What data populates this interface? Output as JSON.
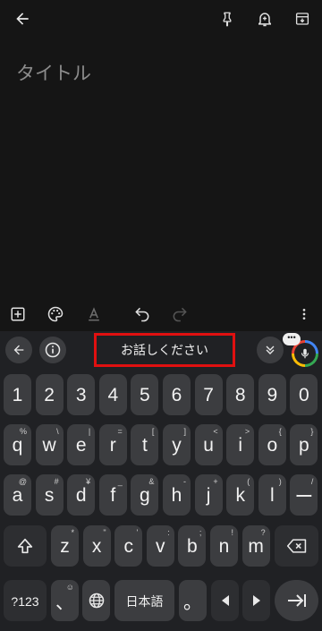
{
  "note": {
    "title_placeholder": "タイトル"
  },
  "keyboard": {
    "suggestion": "お話しください",
    "number_row": [
      "1",
      "2",
      "3",
      "4",
      "5",
      "6",
      "7",
      "8",
      "9",
      "0"
    ],
    "row1": [
      {
        "k": "q",
        "a": "%"
      },
      {
        "k": "w",
        "a": "\\"
      },
      {
        "k": "e",
        "a": "|"
      },
      {
        "k": "r",
        "a": "="
      },
      {
        "k": "t",
        "a": "["
      },
      {
        "k": "y",
        "a": "]"
      },
      {
        "k": "u",
        "a": "<"
      },
      {
        "k": "i",
        "a": ">"
      },
      {
        "k": "o",
        "a": "{"
      },
      {
        "k": "p",
        "a": "}"
      }
    ],
    "row2": [
      {
        "k": "a",
        "a": "@"
      },
      {
        "k": "s",
        "a": "#"
      },
      {
        "k": "d",
        "a": "¥"
      },
      {
        "k": "f",
        "a": "_"
      },
      {
        "k": "g",
        "a": "&"
      },
      {
        "k": "h",
        "a": "-"
      },
      {
        "k": "j",
        "a": "+"
      },
      {
        "k": "k",
        "a": "("
      },
      {
        "k": "l",
        "a": ")"
      },
      {
        "k": "ー",
        "a": "/"
      }
    ],
    "row3": [
      {
        "k": "z",
        "a": "*"
      },
      {
        "k": "x",
        "a": "\""
      },
      {
        "k": "c",
        "a": "'"
      },
      {
        "k": "v",
        "a": ":"
      },
      {
        "k": "b",
        "a": ";"
      },
      {
        "k": "n",
        "a": "!"
      },
      {
        "k": "m",
        "a": "?"
      }
    ],
    "symbols_label": "?123",
    "comma_key": "、",
    "comma_alt": "☺",
    "language_label": "日本語",
    "period_key": "。"
  },
  "icons": {
    "back": "arrow-left-icon",
    "pin": "pin-icon",
    "reminder": "bell-plus-icon",
    "archive": "archive-icon",
    "add": "add-box-icon",
    "palette": "palette-icon",
    "text_format": "text-format-icon",
    "undo": "undo-icon",
    "redo": "redo-icon",
    "more": "more-vert-icon"
  }
}
